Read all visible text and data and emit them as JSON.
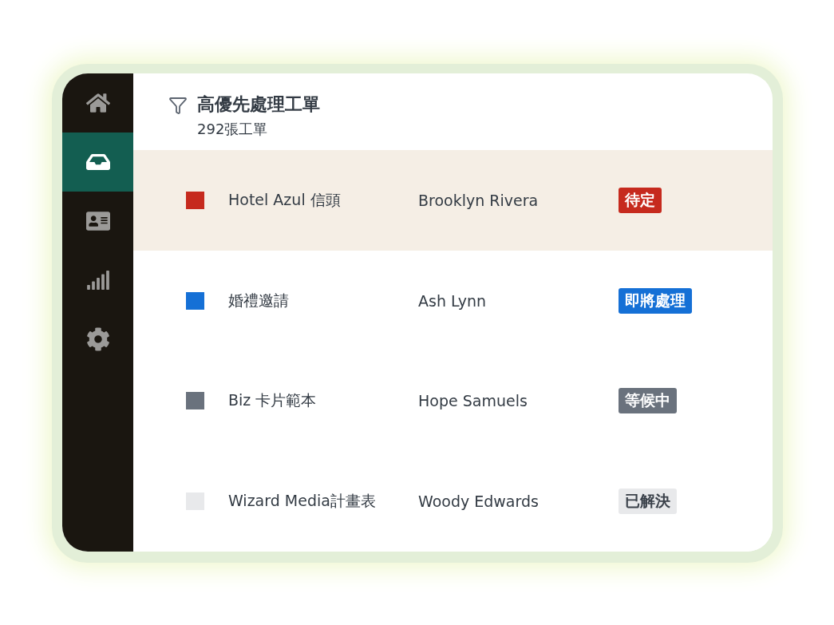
{
  "sidebar": {
    "items": [
      {
        "kind": "home",
        "selected": false
      },
      {
        "kind": "inbox",
        "selected": true
      },
      {
        "kind": "contacts",
        "selected": false
      },
      {
        "kind": "chart",
        "selected": false
      },
      {
        "kind": "settings",
        "selected": false
      }
    ]
  },
  "header": {
    "title": "高優先處理工單",
    "subtitle": "292張工單"
  },
  "tickets": [
    {
      "title": "Hotel Azul 信頭",
      "assignee": "Brooklyn Rivera",
      "status": "待定",
      "color": "#c62a1e",
      "selected": true
    },
    {
      "title": "婚禮邀請",
      "assignee": "Ash Lynn",
      "status": "即將處理",
      "color": "#1570d6",
      "selected": false
    },
    {
      "title": "Biz 卡片範本",
      "assignee": "Hope Samuels",
      "status": "等候中",
      "color": "#6a727d",
      "selected": false
    },
    {
      "title": "Wizard Media計畫表",
      "assignee": "Woody Edwards",
      "status": "已解決",
      "color": "#e8e9eb",
      "selected": false
    }
  ]
}
